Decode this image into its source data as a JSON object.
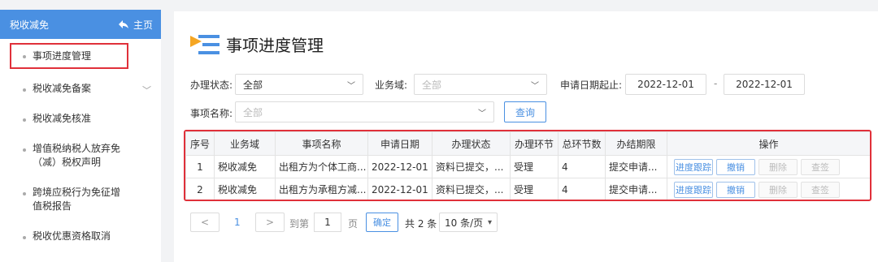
{
  "sidebar": {
    "title": "税收减免",
    "home": "主页",
    "items": [
      {
        "label": "事项进度管理"
      },
      {
        "label": "税收减免备案"
      },
      {
        "label": "税收减免核准"
      },
      {
        "label": "增值税纳税人放弃免（减）税权声明"
      },
      {
        "label": "跨境应税行为免征增值税报告"
      },
      {
        "label": "税收优惠资格取消"
      }
    ]
  },
  "page": {
    "title": "事项进度管理"
  },
  "filters": {
    "status_label": "办理状态:",
    "status_value": "全部",
    "domain_label": "业务域:",
    "domain_placeholder": "全部",
    "date_label": "申请日期起止:",
    "date_start": "2022-12-01",
    "date_sep": "-",
    "date_end": "2022-12-01",
    "name_label": "事项名称:",
    "name_placeholder": "全部",
    "query": "查询"
  },
  "table": {
    "headers": [
      "序号",
      "业务域",
      "事项名称",
      "申请日期",
      "办理状态",
      "办理环节",
      "总环节数",
      "办结期限",
      "操作"
    ],
    "rows": [
      {
        "no": "1",
        "domain": "税收减免",
        "name": "出租方为个体工商...",
        "date": "2022-12-01",
        "status": "资料已提交，...",
        "step": "受理",
        "total": "4",
        "deadline": "提交申请..."
      },
      {
        "no": "2",
        "domain": "税收减免",
        "name": "出租方为承租方减...",
        "date": "2022-12-01",
        "status": "资料已提交，...",
        "step": "受理",
        "total": "4",
        "deadline": "提交申请..."
      }
    ],
    "actions": {
      "track": "进度跟踪",
      "revoke": "撤销",
      "delete": "删除",
      "sign": "查签"
    }
  },
  "pagination": {
    "prev": "<",
    "current": "1",
    "next": ">",
    "goto": "到第",
    "page_input": "1",
    "page_unit": "页",
    "confirm": "确定",
    "total": "共 2 条",
    "page_size": "10 条/页"
  },
  "colors": {
    "accent": "#4a90e2",
    "highlight": "#e0303a"
  }
}
